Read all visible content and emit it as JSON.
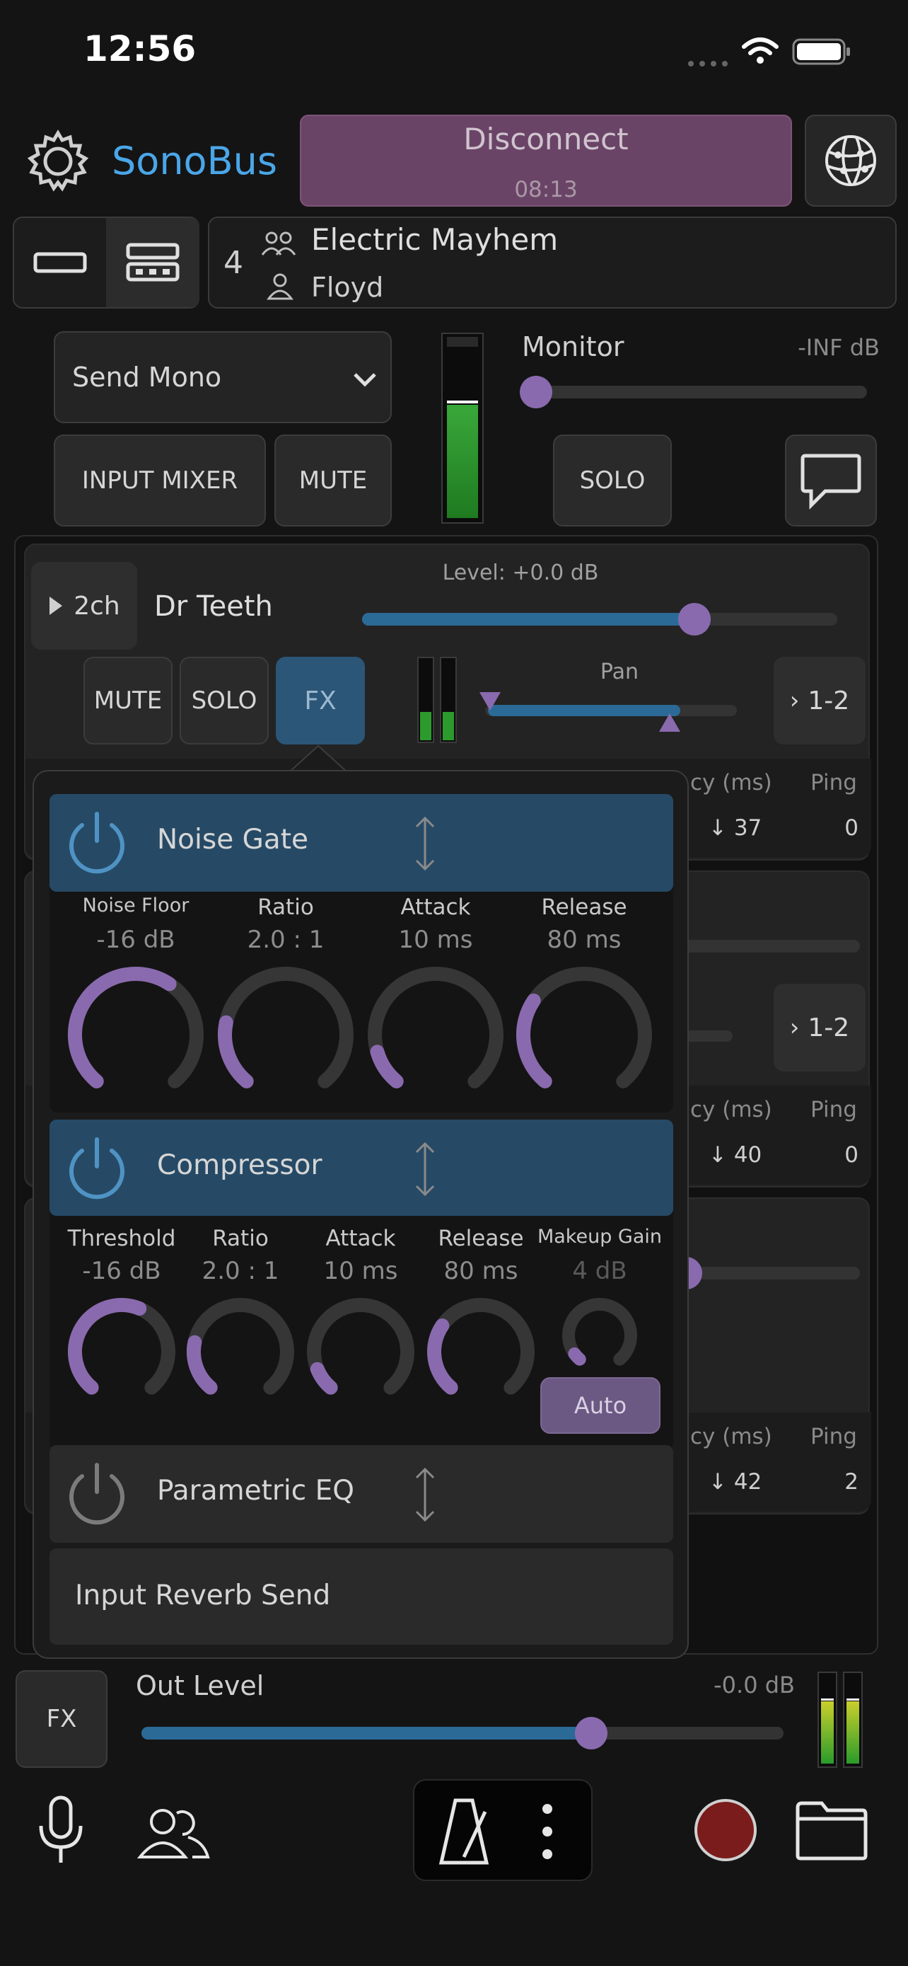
{
  "status_bar": {
    "time": "12:56"
  },
  "header": {
    "app_name": "SonoBus",
    "connect": {
      "label": "Disconnect",
      "timer": "08:13"
    }
  },
  "group": {
    "count": "4",
    "name": "Electric Mayhem",
    "user": "Floyd"
  },
  "input": {
    "send_mode": "Send Mono",
    "input_mixer_label": "INPUT MIXER",
    "mute_label": "MUTE",
    "solo_label": "SOLO",
    "monitor_label": "Monitor",
    "monitor_value": "-INF dB",
    "monitor_level": 0.0
  },
  "peer": {
    "channels": "2ch",
    "name": "Dr Teeth",
    "level_text": "Level: +0.0 dB",
    "level_fraction": 0.7,
    "mute_label": "MUTE",
    "solo_label": "SOLO",
    "fx_label": "FX",
    "pan_label": "Pan",
    "route_label": "1-2"
  },
  "background_rows": [
    {
      "latency_header": "cy (ms)",
      "ping_header": "Ping",
      "latency": "↓ 37",
      "ping": "0"
    },
    {
      "latency_header": "cy (ms)",
      "ping_header": "Ping",
      "latency": "↓ 40",
      "ping": "0",
      "route_label": "1-2"
    },
    {
      "latency_header": "cy (ms)",
      "ping_header": "Ping",
      "latency": "↓ 42",
      "ping": "2"
    }
  ],
  "fx_popup": {
    "noise_gate": {
      "title": "Noise Gate",
      "knobs": [
        {
          "label": "Noise Floor",
          "value": "-16 dB",
          "level": 0.62
        },
        {
          "label": "Ratio",
          "value": "2.0 : 1",
          "level": 0.22
        },
        {
          "label": "Attack",
          "value": "10 ms",
          "level": 0.12
        },
        {
          "label": "Release",
          "value": "80 ms",
          "level": 0.3
        }
      ]
    },
    "compressor": {
      "title": "Compressor",
      "knobs": [
        {
          "label": "Threshold",
          "value": "-16 dB",
          "level": 0.58
        },
        {
          "label": "Ratio",
          "value": "2.0 : 1",
          "level": 0.22
        },
        {
          "label": "Attack",
          "value": "10 ms",
          "level": 0.1
        },
        {
          "label": "Release",
          "value": "80 ms",
          "level": 0.3
        },
        {
          "label": "Makeup Gain",
          "value": "4 dB",
          "level": 0.05
        }
      ],
      "auto_label": "Auto"
    },
    "eq": {
      "title": "Parametric EQ"
    },
    "reverb": {
      "title": "Input Reverb Send"
    }
  },
  "output": {
    "fx_label": "FX",
    "label": "Out Level",
    "value": "-0.0 dB",
    "level_fraction": 0.7
  },
  "colors": {
    "accent_blue": "#4aa6e8",
    "knob_purple": "#8a6aae",
    "fx_header_blue": "#264a66",
    "disconnect_bg": "#6a4466",
    "record_red": "#7a1c1c"
  }
}
